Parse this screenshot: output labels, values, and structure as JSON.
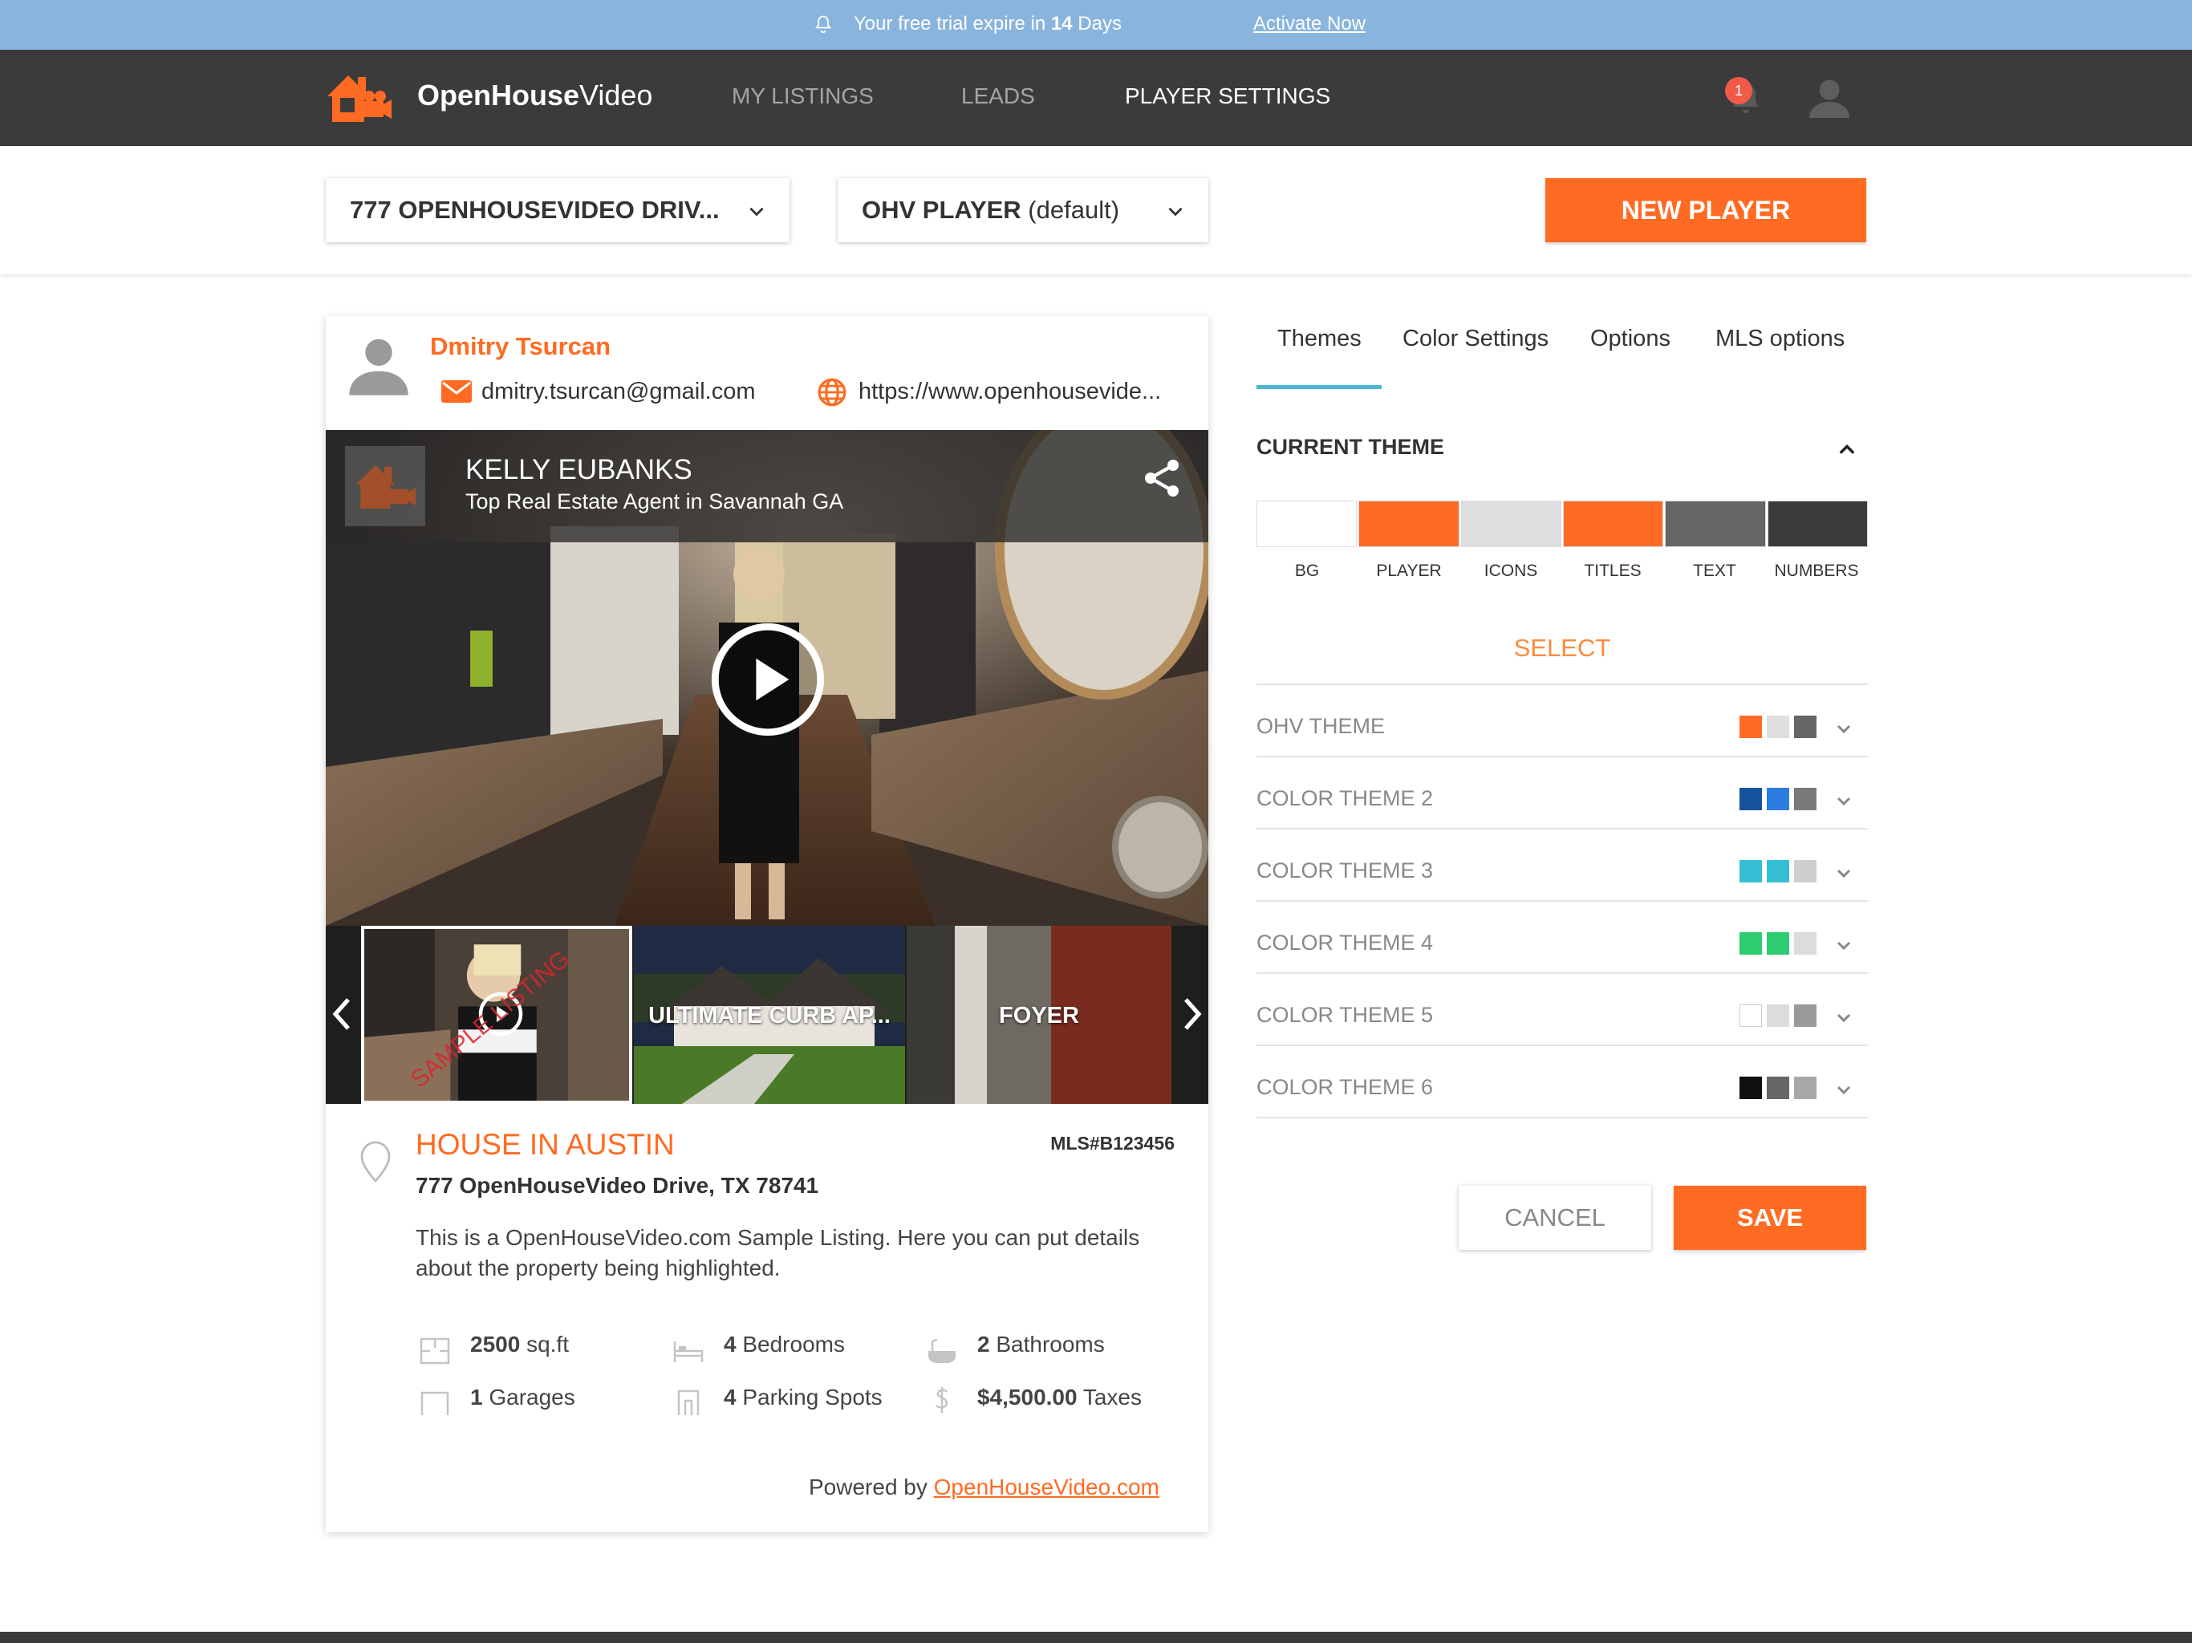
{
  "trial": {
    "message_before": "Your free trial expire in ",
    "days": "14",
    "message_after": " Days",
    "activate_label": "Activate Now"
  },
  "nav": {
    "logo_strong": "OpenHouse",
    "logo_light": "Video",
    "items": [
      {
        "label": "MY LISTINGS"
      },
      {
        "label": "LEADS"
      },
      {
        "label": "PLAYER SETTINGS"
      }
    ],
    "notification_count": "1"
  },
  "toolbar": {
    "listing_select": "777 OPENHOUSEVIDEO DRIV...",
    "player_select_strong": "OHV PLAYER",
    "player_select_suffix": " (default)",
    "new_player_label": "NEW PLAYER"
  },
  "card": {
    "agent_name": "Dmitry Tsurcan",
    "agent_email": "dmitry.tsurcan@gmail.com",
    "agent_url": "https://www.openhousevide...",
    "video_title": "KELLY EUBANKS",
    "video_subtitle": "Top Real Estate Agent in Savannah GA",
    "thumbnails": [
      {
        "label": "",
        "watermark": "SAMPLE LISTING"
      },
      {
        "label": "ULTIMATE CURB AP...",
        "watermark": ""
      },
      {
        "label": "FOYER",
        "watermark": ""
      }
    ],
    "listing_title": "HOUSE IN AUSTIN",
    "mls": "MLS#B123456",
    "address": "777 OpenHouseVideo Drive, TX 78741",
    "description": "This is a OpenHouseVideo.com Sample Listing. Here you can put details about the property being highlighted.",
    "stats": [
      {
        "num": "2500",
        "unit": " sq.ft"
      },
      {
        "num": "4",
        "unit": " Bedrooms"
      },
      {
        "num": "2",
        "unit": " Bathrooms"
      },
      {
        "num": "1",
        "unit": " Garages"
      },
      {
        "num": "4",
        "unit": " Parking Spots"
      },
      {
        "num": "$4,500.00",
        "unit": " Taxes"
      }
    ],
    "powered_by": "Powered by ",
    "powered_link": "OpenHouseVideo.com"
  },
  "panel": {
    "tabs": [
      {
        "label": "Themes"
      },
      {
        "label": "Color Settings"
      },
      {
        "label": "Options"
      },
      {
        "label": "MLS options"
      }
    ],
    "current_theme_title": "CURRENT THEME",
    "current_swatches": [
      {
        "label": "BG",
        "color": "#ffffff"
      },
      {
        "label": "PLAYER",
        "color": "#ff6b22"
      },
      {
        "label": "ICONS",
        "color": "#dedede"
      },
      {
        "label": "TITLES",
        "color": "#ff6b22"
      },
      {
        "label": "TEXT",
        "color": "#666666"
      },
      {
        "label": "NUMBERS",
        "color": "#3b3b3b"
      }
    ],
    "select_title": "SELECT",
    "themes": [
      {
        "name": "OHV THEME",
        "colors": [
          "#ff6b22",
          "#dedede",
          "#666666"
        ]
      },
      {
        "name": "COLOR THEME 2",
        "colors": [
          "#15539e",
          "#2b7de0",
          "#7a7a7a"
        ]
      },
      {
        "name": "COLOR THEME 3",
        "colors": [
          "#35bfd4",
          "#35bfd4",
          "#cfcfcf"
        ]
      },
      {
        "name": "COLOR THEME 4",
        "colors": [
          "#2ecc71",
          "#2ecc71",
          "#dcdcdc"
        ]
      },
      {
        "name": "COLOR THEME 5",
        "colors": [
          "#ffffff",
          "#dcdcdc",
          "#9a9a9a"
        ]
      },
      {
        "name": "COLOR THEME 6",
        "colors": [
          "#111111",
          "#666666",
          "#a8a8a8"
        ]
      }
    ],
    "cancel_label": "CANCEL",
    "save_label": "SAVE"
  },
  "colors": {
    "accent": "#ff6b22",
    "banner": "#89b4dd",
    "nav_bg": "#3b3b3b",
    "tab_underline": "#4fb3d3"
  }
}
